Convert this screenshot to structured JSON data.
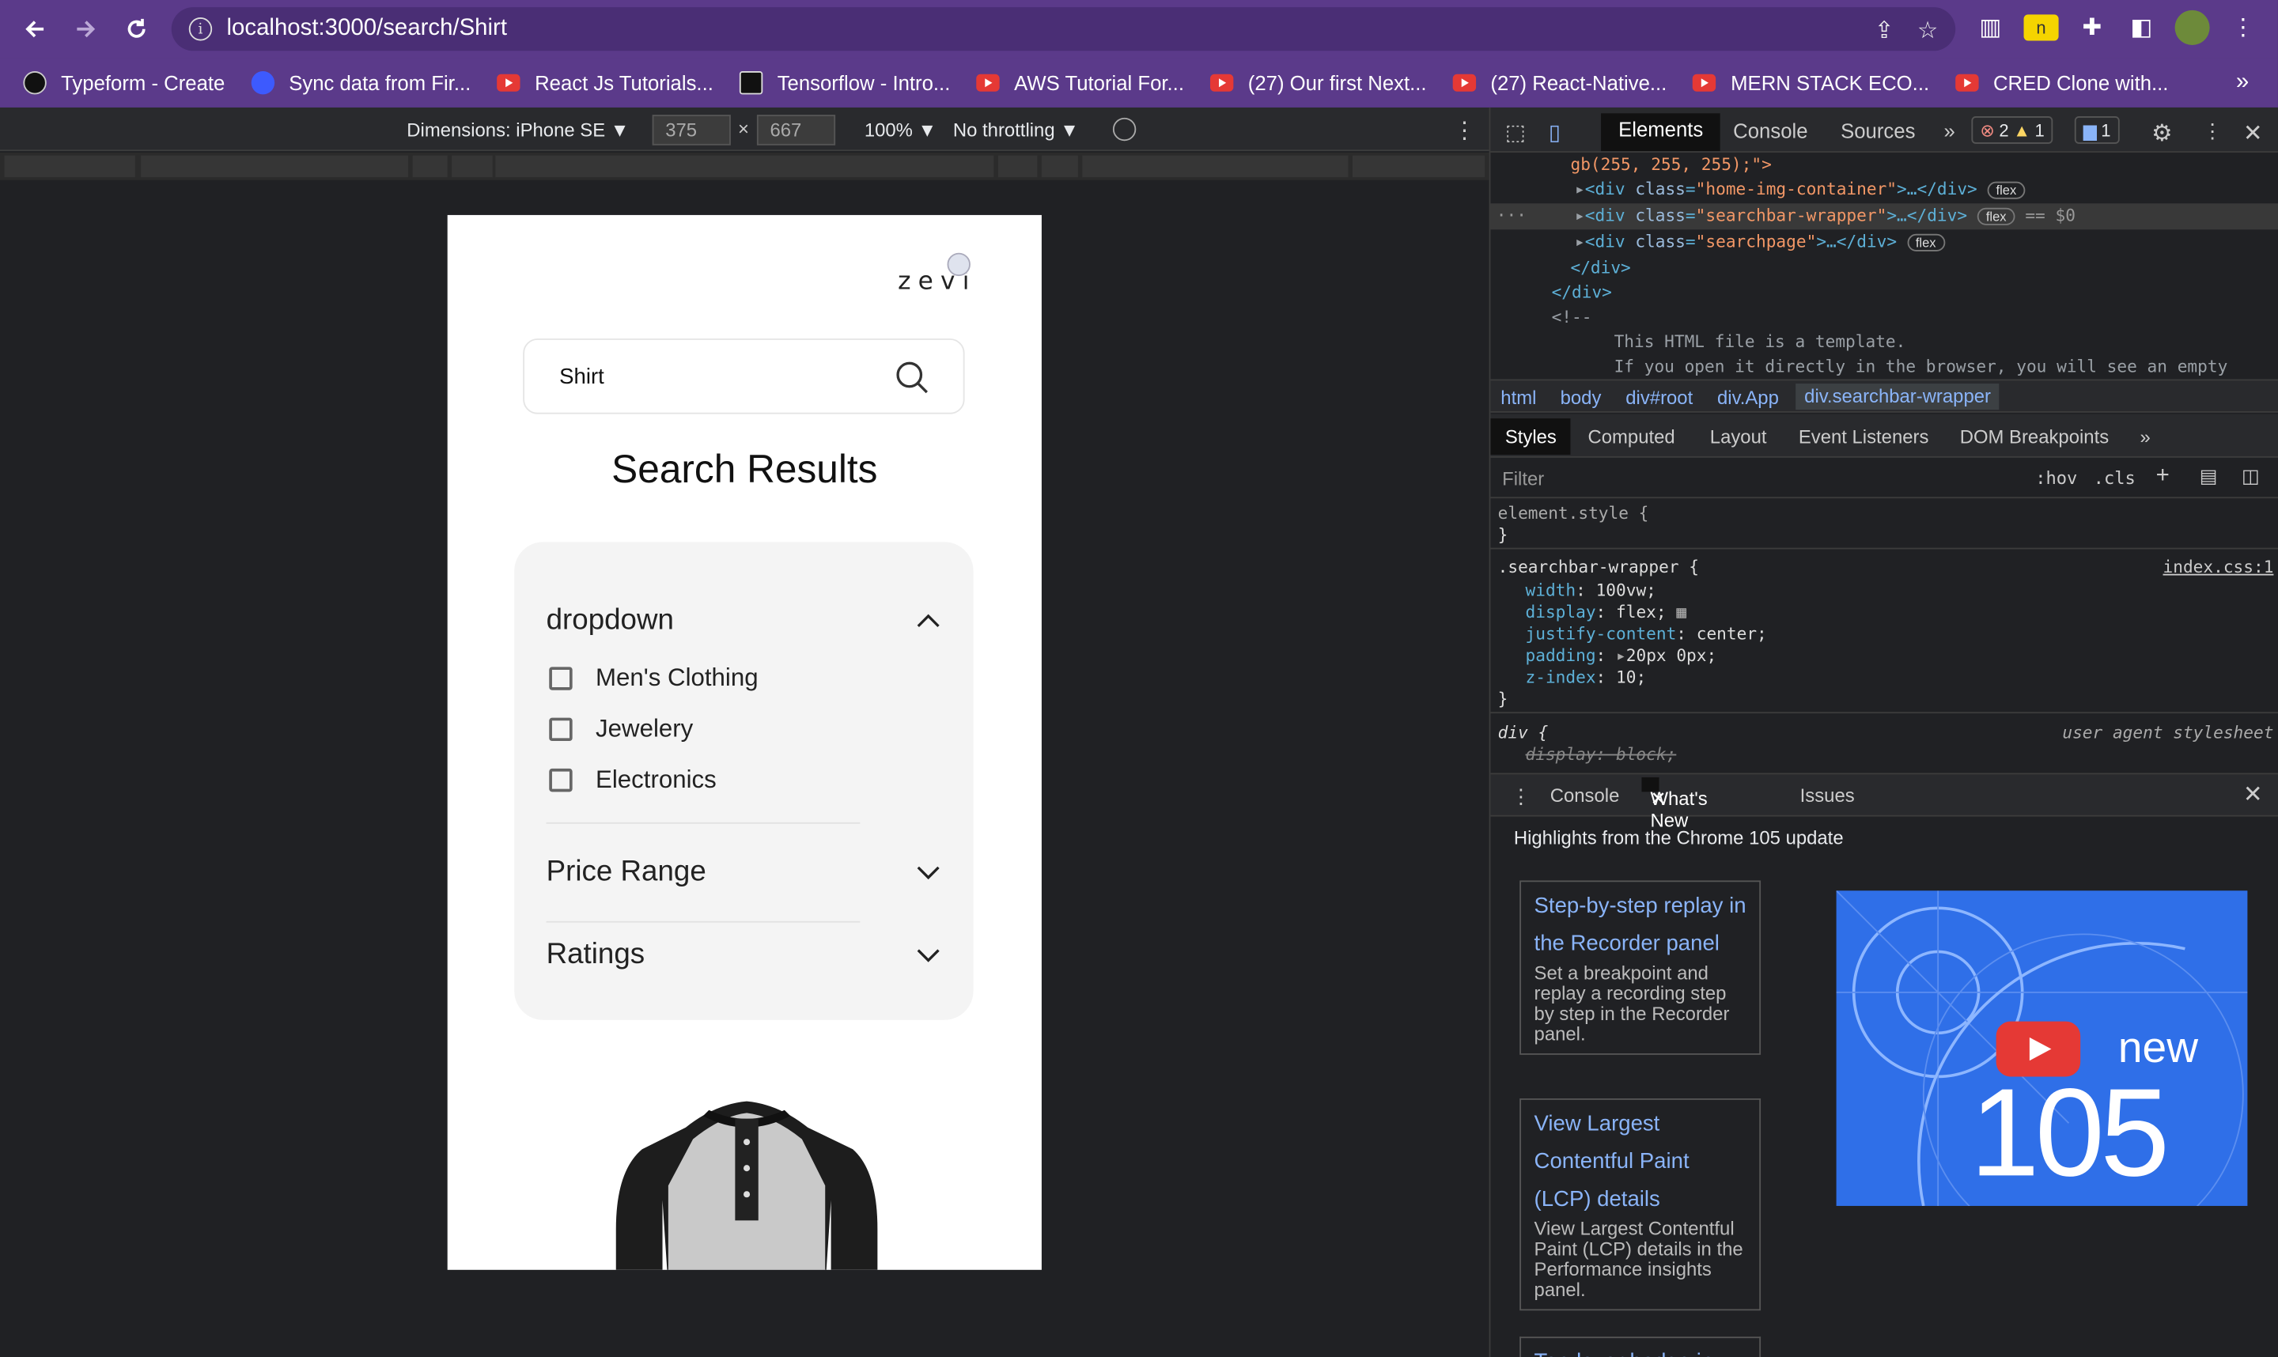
{
  "browser": {
    "url": "localhost:3000/search/Shirt",
    "bookmarks": [
      {
        "label": "Typeform - Create",
        "icon": "typeform-icon"
      },
      {
        "label": "Sync data from Fir...",
        "icon": "sync-icon"
      },
      {
        "label": "React Js Tutorials...",
        "icon": "youtube-icon"
      },
      {
        "label": "Tensorflow - Intro...",
        "icon": "tensorflow-icon"
      },
      {
        "label": "AWS Tutorial For...",
        "icon": "youtube-icon"
      },
      {
        "label": "(27) Our first Next...",
        "icon": "youtube-icon"
      },
      {
        "label": "(27) React-Native...",
        "icon": "youtube-icon"
      },
      {
        "label": "MERN STACK ECO...",
        "icon": "youtube-icon"
      },
      {
        "label": "CRED Clone with...",
        "icon": "youtube-icon"
      }
    ],
    "more": "»"
  },
  "device_toolbar": {
    "dimensions": "Dimensions: iPhone SE ▼",
    "width": "375",
    "height": "667",
    "times": "×",
    "zoom": "100% ▼",
    "throttle": "No throttling ▼"
  },
  "app": {
    "logo": "zevi",
    "search_value": "Shirt",
    "results_title": "Search Results",
    "filters": {
      "dropdown_label": "dropdown",
      "options": [
        "Men's Clothing",
        "Jewelery",
        "Electronics"
      ],
      "price_label": "Price Range",
      "ratings_label": "Ratings"
    }
  },
  "devtools": {
    "tabs": [
      "Elements",
      "Console",
      "Sources"
    ],
    "more_tabs": "»",
    "errors": "2",
    "warnings": "1",
    "messages": "1",
    "code_lines": {
      "l0": "gb(255, 255, 255);\">",
      "home_class": "home-img-container",
      "searchbar_class": "searchbar-wrapper",
      "searchpage_class": "searchpage",
      "flex": "flex",
      "eq": "== $0",
      "close_div": "</div>",
      "comment_open": "<!--",
      "comment_1": "This HTML file is a template.",
      "comment_2": "If you open it directly in the browser, you will see an empty"
    },
    "breadcrumbs": [
      "html",
      "body",
      "div#root",
      "div.App",
      "div.searchbar-wrapper"
    ],
    "subtabs": [
      "Styles",
      "Computed",
      "Layout",
      "Event Listeners",
      "DOM Breakpoints"
    ],
    "filter_placeholder": "Filter",
    "hov": ":hov",
    "cls": ".cls",
    "styles": {
      "element_style": "element.style {",
      "close_brace": "}",
      "selector": ".searchbar-wrapper {",
      "source": "index.css:1",
      "props": [
        {
          "name": "width",
          "value": "100vw;"
        },
        {
          "name": "display",
          "value": "flex;"
        },
        {
          "name": "justify-content",
          "value": "center;"
        },
        {
          "name": "padding",
          "value": "20px 0px;"
        },
        {
          "name": "z-index",
          "value": "10;"
        }
      ],
      "div_rule": "div {",
      "ua": "user agent stylesheet",
      "struck": "display: block;"
    },
    "drawer_tabs": [
      "Console",
      "What's New",
      "Issues"
    ],
    "highlights": "Highlights from the Chrome 105 update",
    "cards": [
      {
        "title": "Step-by-step replay in the Recorder panel",
        "desc": "Set a breakpoint and replay a recording step by step in the Recorder panel."
      },
      {
        "title": "View Largest Contentful Paint (LCP) details",
        "desc": "View Largest Contentful Paint (LCP) details in the Performance insights panel."
      },
      {
        "title": "Top-layer badge in",
        "desc": ""
      }
    ],
    "promo": {
      "new": "new",
      "version": "105"
    }
  }
}
